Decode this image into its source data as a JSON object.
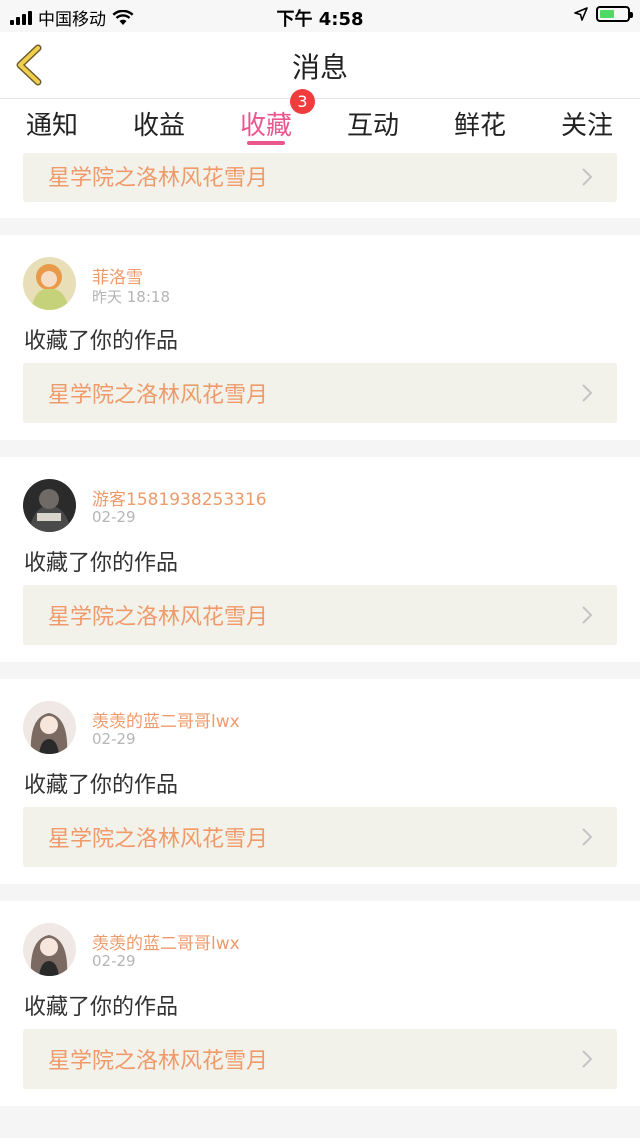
{
  "status_bar": {
    "carrier": "中国移动",
    "time": "下午 4:58",
    "battery_level": 0.55,
    "icons": [
      "signal-icon",
      "wifi-icon",
      "location-arrow-icon",
      "battery-charging-icon"
    ]
  },
  "nav": {
    "title": "消息",
    "back_icon": "chevron-left-icon"
  },
  "tabs": [
    {
      "label": "通知",
      "active": false
    },
    {
      "label": "收益",
      "active": false
    },
    {
      "label": "收藏",
      "active": true,
      "badge": "3"
    },
    {
      "label": "互动",
      "active": false
    },
    {
      "label": "鲜花",
      "active": false
    },
    {
      "label": "关注",
      "active": false
    }
  ],
  "colors": {
    "accent": "#e8588d",
    "badge": "#f03c3c",
    "username": "#ef9a6b",
    "work_box": "#f3f2ea"
  },
  "partial_top_work": "星学院之洛林风花雪月",
  "messages": [
    {
      "user": "菲洛雪",
      "time": "昨天 18:18",
      "text": "收藏了你的作品",
      "work": "星学院之洛林风花雪月"
    },
    {
      "user": "游客1581938253316",
      "time": "02-29",
      "text": "收藏了你的作品",
      "work": "星学院之洛林风花雪月"
    },
    {
      "user": "羡羡的蓝二哥哥lwx",
      "time": "02-29",
      "text": "收藏了你的作品",
      "work": "星学院之洛林风花雪月"
    },
    {
      "user": "羡羡的蓝二哥哥lwx",
      "time": "02-29",
      "text": "收藏了你的作品",
      "work": "星学院之洛林风花雪月"
    }
  ]
}
